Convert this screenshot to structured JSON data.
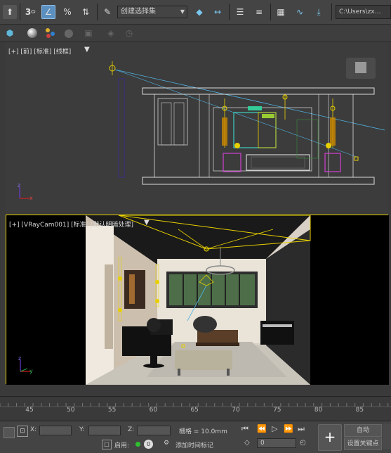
{
  "toolbar": {
    "selection_set": "创建选择集",
    "path": "C:\\Users\\zx…"
  },
  "top_viewport": {
    "label": "[+] [前] [标准] [线框]"
  },
  "camera_viewport": {
    "label": "[+] [VRayCam001] [标准] [默认明暗处理]"
  },
  "axis": {
    "x": "x",
    "y": "y",
    "z": "z"
  },
  "timeline": {
    "ticks": [
      "45",
      "50",
      "55",
      "60",
      "65",
      "70",
      "75",
      "80",
      "85"
    ]
  },
  "status": {
    "x_label": "X:",
    "y_label": "Y:",
    "z_label": "Z:",
    "grid": "栅格 = 10.0mm",
    "enable_label": "启用:",
    "add_time_tag": "添加时间标记",
    "frame_value": "0",
    "auto_key": "自动",
    "set_key": "设置关键点"
  },
  "colors": {
    "accent": "#5a8fbf",
    "viewport_border": "#e8d000",
    "viewport_bg": "#3c3c3c"
  }
}
